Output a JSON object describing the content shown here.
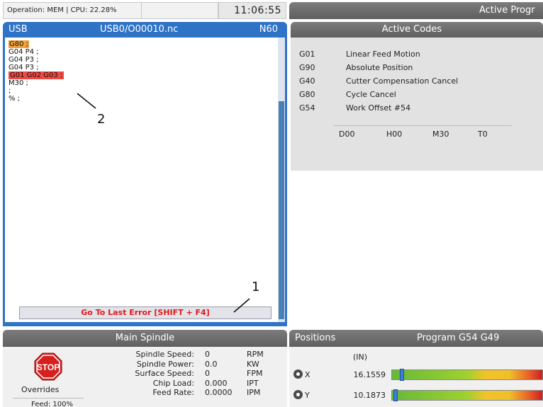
{
  "status_bar": {
    "operation": "Operation: MEM | CPU: 22.28%",
    "clock": "11:06:55"
  },
  "active_program_title": "Active Progr",
  "editor": {
    "source": "USB",
    "path": "USB0/O00010.nc",
    "block": "N60",
    "lines": [
      {
        "text": "G80 ;",
        "highlight": "current"
      },
      {
        "text": "G04 P4 ;",
        "highlight": "none"
      },
      {
        "text": "G04 P3 ;",
        "highlight": "none"
      },
      {
        "text": "G04 P3 ;",
        "highlight": "none"
      },
      {
        "text": "G01 G02 G03 ;",
        "highlight": "error"
      },
      {
        "text": "M30 ;",
        "highlight": "none"
      },
      {
        "text": ";",
        "highlight": "none"
      },
      {
        "text": "% ;",
        "highlight": "none"
      }
    ],
    "goto_error": "Go To Last Error [SHIFT + F4]"
  },
  "callouts": {
    "one": "1",
    "two": "2"
  },
  "active_codes": {
    "title": "Active Codes",
    "codes": [
      {
        "code": "G01",
        "description": "Linear Feed Motion"
      },
      {
        "code": "G90",
        "description": "Absolute Position"
      },
      {
        "code": "G40",
        "description": "Cutter Compensation Cancel"
      },
      {
        "code": "G80",
        "description": "Cycle Cancel"
      },
      {
        "code": "G54",
        "description": "Work Offset #54"
      }
    ],
    "bottom": [
      "D00",
      "H00",
      "M30",
      "T0"
    ]
  },
  "spindle": {
    "title": "Main Spindle",
    "stop_label": "STOP",
    "overrides_label": "Overrides",
    "feed_label": "Feed: 100%",
    "rows": [
      {
        "label": "Spindle Speed:",
        "value": "0",
        "unit": "RPM"
      },
      {
        "label": "Spindle Power:",
        "value": "0.0",
        "unit": "KW"
      },
      {
        "label": "Surface Speed:",
        "value": "0",
        "unit": "FPM"
      },
      {
        "label": "Chip Load:",
        "value": "0.000",
        "unit": "IPT"
      },
      {
        "label": "Feed Rate:",
        "value": "0.0000",
        "unit": "IPM"
      }
    ]
  },
  "positions": {
    "title": "Positions",
    "program_label": "Program G54 G49",
    "units": "(IN)",
    "axes": [
      {
        "name": "X",
        "value": "16.1559",
        "load_fraction": 0.05
      },
      {
        "name": "Y",
        "value": "10.1873",
        "load_fraction": 0.01
      }
    ]
  },
  "colors": {
    "editor_blue": "#2f73c7",
    "current_line_highlight": "#f3a13a",
    "error_line_highlight": "#ee4a43",
    "error_text": "#e21a1a",
    "header_gray": "#6e6e6e"
  }
}
